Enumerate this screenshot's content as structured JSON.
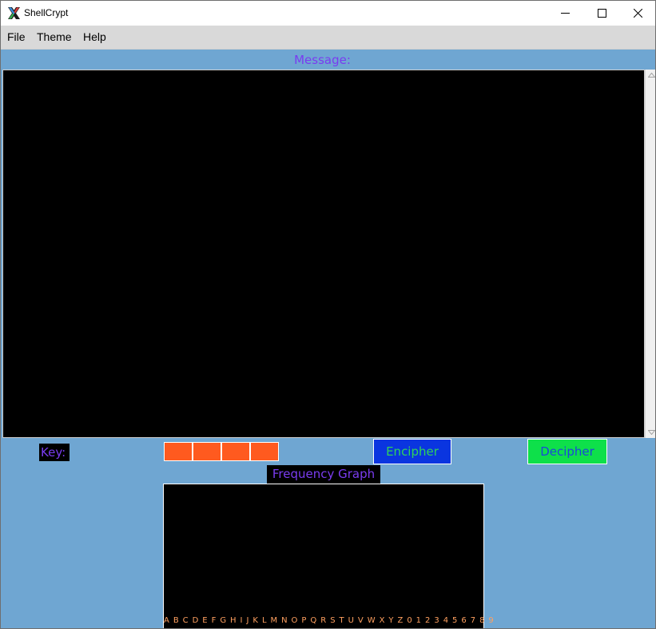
{
  "window": {
    "title": "ShellCrypt",
    "app_icon": "x-logo-icon",
    "controls": {
      "minimize": "minimize-icon",
      "maximize": "maximize-icon",
      "close": "close-icon"
    }
  },
  "menu": {
    "items": [
      {
        "label": "File"
      },
      {
        "label": "Theme"
      },
      {
        "label": "Help"
      }
    ]
  },
  "message": {
    "label": "Message:",
    "text": ""
  },
  "key": {
    "label": "Key:",
    "fields": [
      "",
      "",
      "",
      ""
    ]
  },
  "actions": {
    "encipher_label": "Encipher",
    "decipher_label": "Decipher"
  },
  "frequency": {
    "label": "Frequency Graph",
    "axis_labels": "A B C D E F G H I J K L M N O P Q R S T U V W X Y Z 0 1 2 3 4 5 6 7 8 9"
  },
  "colors": {
    "background": "#6fa6d2",
    "label_text": "#7a3cf0",
    "key_fill": "#ff5a1f",
    "encipher_bg": "#0a35e0",
    "decipher_bg": "#0ee04a",
    "axis_text": "#ffa060"
  }
}
